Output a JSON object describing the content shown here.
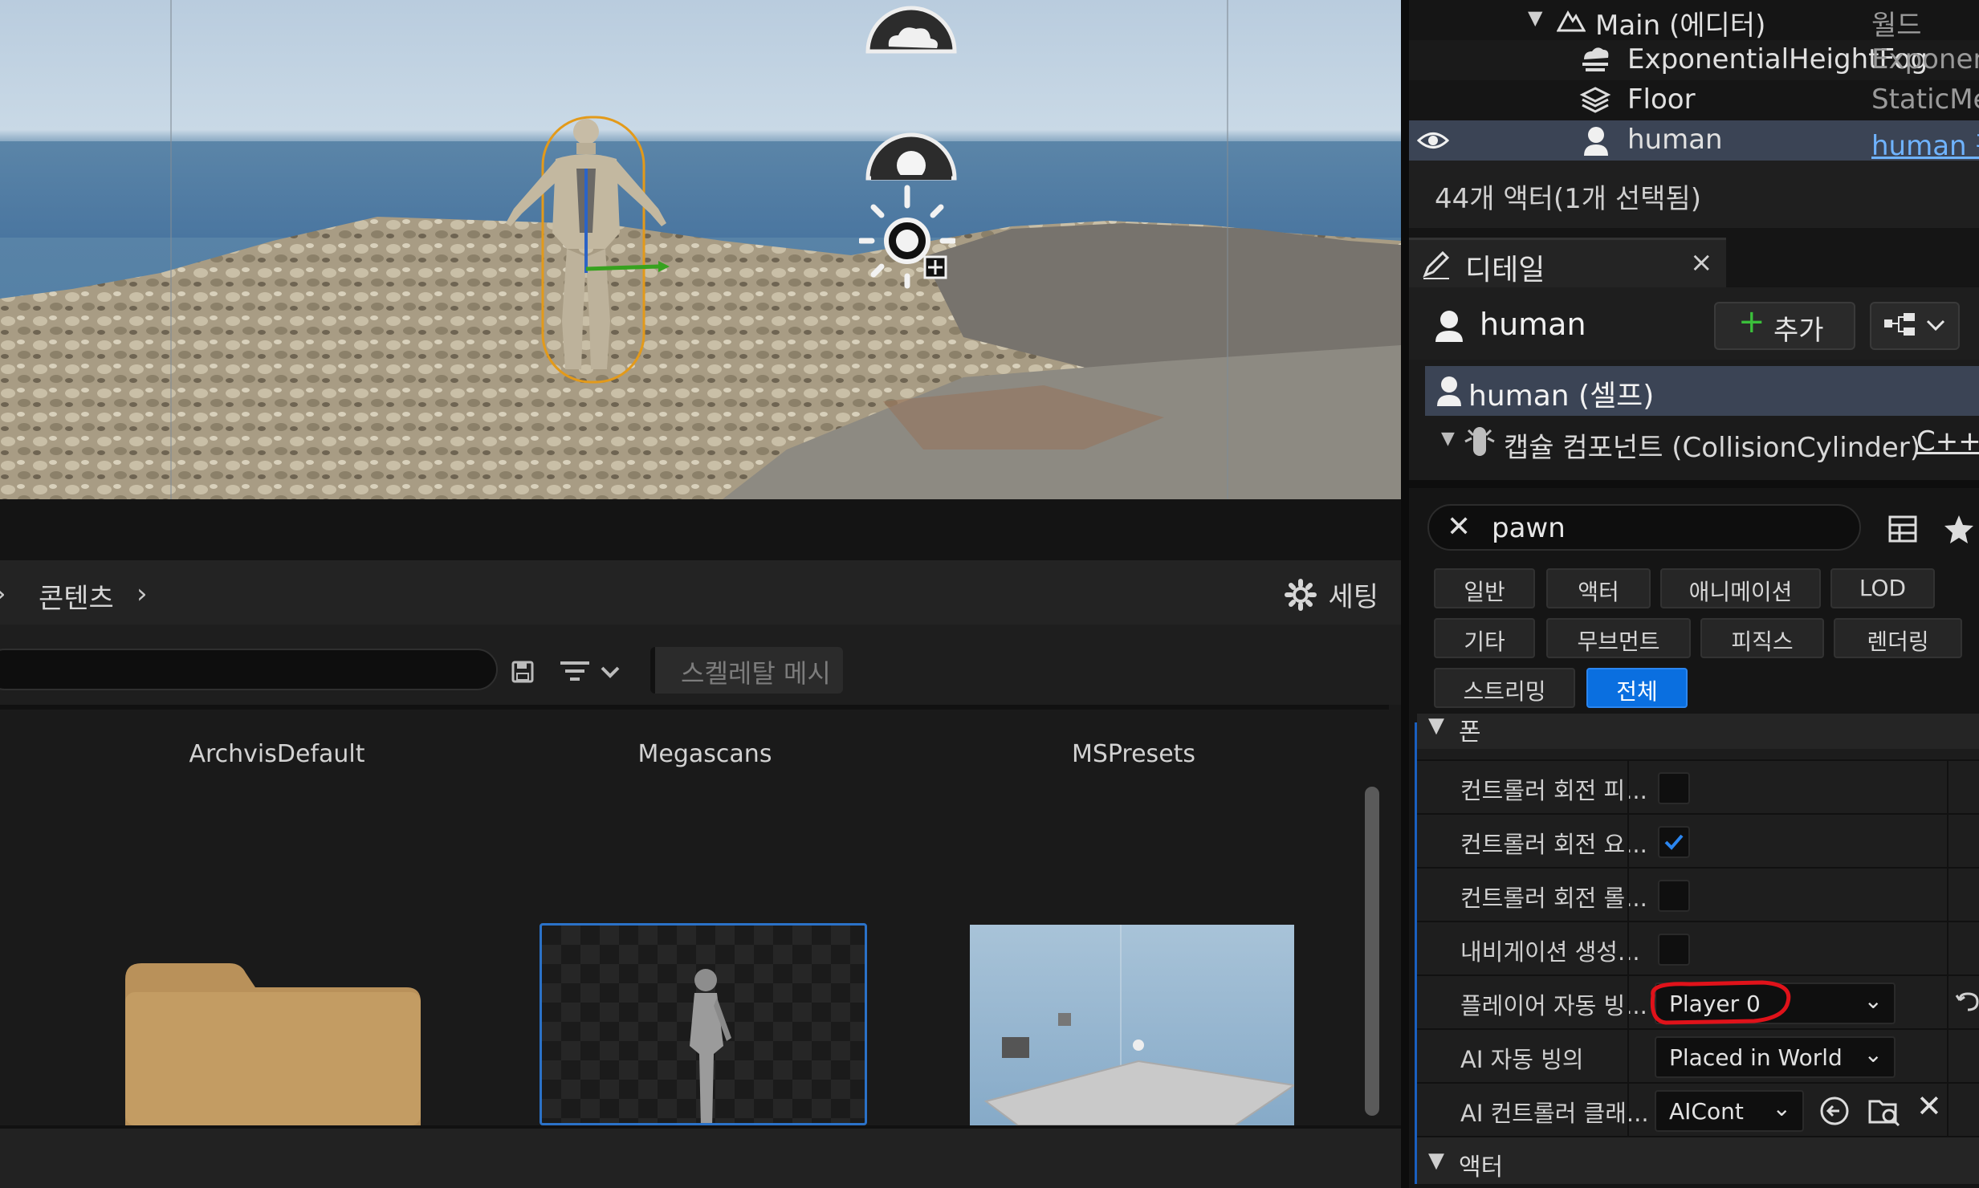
{
  "outliner": {
    "rows": [
      {
        "name": "Main (에디터)",
        "type": "월드"
      },
      {
        "name": "ExponentialHeightFog",
        "type": "ExponentialHeightFog"
      },
      {
        "name": "Floor",
        "type": "StaticMeshActor"
      },
      {
        "name": "human",
        "type": "human 편집"
      }
    ],
    "status": "44개 액터(1개 선택됨)"
  },
  "details": {
    "tab_title": "디테일",
    "close_glyph": "×",
    "actor_name": "human",
    "add_label": "추가",
    "components": {
      "self": "human (셀프)",
      "capsule": "캡슐 컴포넌트 (CollisionCylinder)",
      "capsule_type": "C++"
    },
    "search_value": "pawn",
    "categories": [
      "일반",
      "액터",
      "애니메이션",
      "LOD",
      "기타",
      "무브먼트",
      "피직스",
      "렌더링",
      "스트리밍",
      "전체"
    ],
    "active_category": "전체",
    "section_pawn": "폰",
    "section_actor": "액터",
    "props": [
      {
        "label": "컨트롤러 회전 피...",
        "kind": "checkbox",
        "checked": false
      },
      {
        "label": "컨트롤러 회전 요...",
        "kind": "checkbox",
        "checked": true
      },
      {
        "label": "컨트롤러 회전 롤...",
        "kind": "checkbox",
        "checked": false
      },
      {
        "label": "내비게이션 생성...",
        "kind": "checkbox",
        "checked": false
      },
      {
        "label": "플레이어 자동 빙...",
        "kind": "dropdown",
        "value": "Player 0"
      },
      {
        "label": "AI 자동 빙의",
        "kind": "dropdown",
        "value": "Placed in World"
      },
      {
        "label": "AI 컨트롤러 클래...",
        "kind": "class",
        "value": "AICont"
      }
    ]
  },
  "content_browser": {
    "path": "콘텐츠",
    "settings_label": "세팅",
    "filter_chip": "스켈레탈 메시",
    "items": [
      "ArchvisDefault",
      "Megascans",
      "MSPresets"
    ]
  },
  "colors": {
    "accent": "#0a6fe0",
    "highlight_circle": "#e0121a",
    "selection_row": "#3b4455",
    "folder": "#b9915a"
  }
}
